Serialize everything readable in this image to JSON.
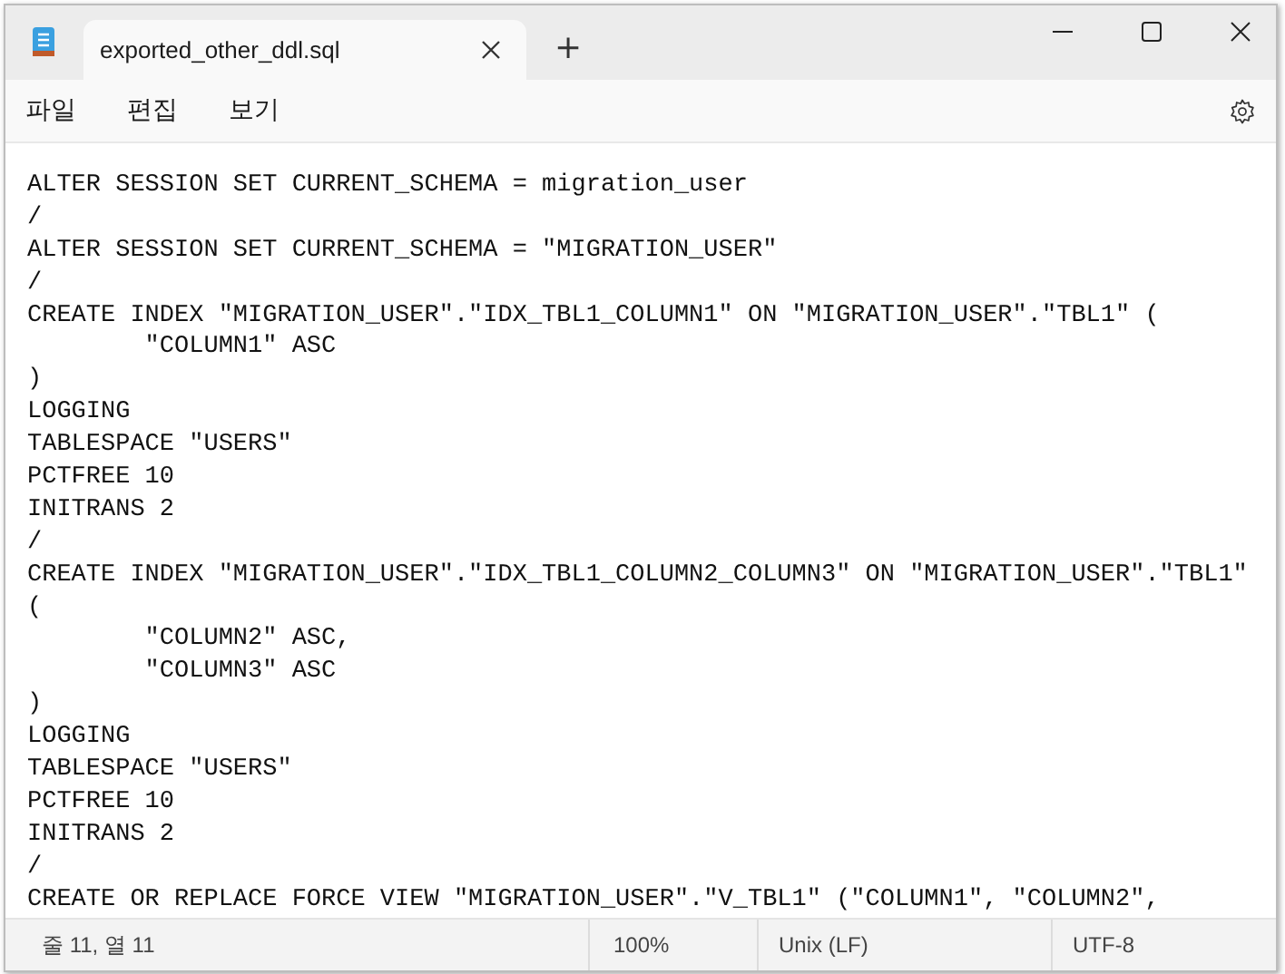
{
  "window": {
    "tab_title": "exported_other_ddl.sql",
    "new_tab": "+"
  },
  "menu": [
    "파일",
    "편집",
    "보기"
  ],
  "editor": {
    "lines": [
      "ALTER SESSION SET CURRENT_SCHEMA = migration_user",
      "/",
      "ALTER SESSION SET CURRENT_SCHEMA = \"MIGRATION_USER\"",
      "/",
      "CREATE INDEX \"MIGRATION_USER\".\"IDX_TBL1_COLUMN1\" ON \"MIGRATION_USER\".\"TBL1\" (",
      "        \"COLUMN1\" ASC",
      ")",
      "LOGGING",
      "TABLESPACE \"USERS\"",
      "PCTFREE 10",
      "INITRANS 2",
      "/",
      "CREATE INDEX \"MIGRATION_USER\".\"IDX_TBL1_COLUMN2_COLUMN3\" ON \"MIGRATION_USER\".\"TBL1\"",
      "(",
      "        \"COLUMN2\" ASC,",
      "        \"COLUMN3\" ASC",
      ")",
      "LOGGING",
      "TABLESPACE \"USERS\"",
      "PCTFREE 10",
      "INITRANS 2",
      "/",
      "CREATE OR REPLACE FORCE VIEW \"MIGRATION_USER\".\"V_TBL1\" (\"COLUMN1\", \"COLUMN2\","
    ]
  },
  "status_bar": [
    "줄 11, 열 11",
    "100%",
    "Unix (LF)",
    "UTF-8"
  ]
}
